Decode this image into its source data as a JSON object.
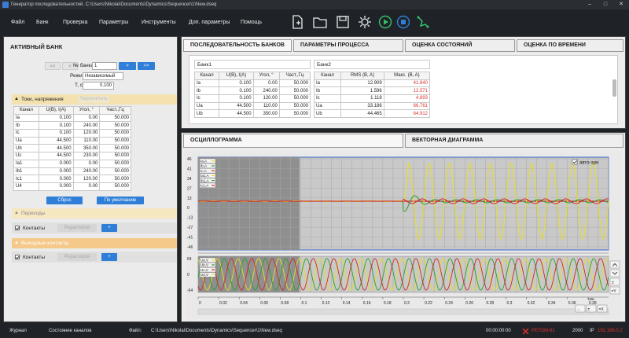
{
  "window": {
    "title": "Генератор последовательностей. C:\\Users\\Nikolai\\Documents\\Dynamics\\Sequencer\\1\\New.dseq"
  },
  "menu": {
    "items": [
      "Файл",
      "Банк",
      "Проверка",
      "Параметры",
      "Инструменты",
      "Доп. параметры",
      "Помощь"
    ]
  },
  "left": {
    "title": "АКТИВНЫЙ БАНК",
    "nav": {
      "first": "<<",
      "prev": "<",
      "bank_label": "№ банка",
      "bank_value": "1",
      "next": ">",
      "last": ">>"
    },
    "mode_label": "Режим",
    "mode_value": "Независимый",
    "t_label": "T, c",
    "t_value": "0.100",
    "currents_section": "Токи, напряжения",
    "recalc_label": "Пересчитать",
    "table_headers": [
      "Канал",
      "U(B), I(A)",
      "Угол, °",
      "Част.,Гц"
    ],
    "rows": [
      [
        "Ia",
        "0.100",
        "0.00",
        "50.000"
      ],
      [
        "Ib",
        "0.100",
        "240.00",
        "50.000"
      ],
      [
        "Ic",
        "0.100",
        "120.00",
        "50.000"
      ],
      [
        "Ua",
        "44.500",
        "110.00",
        "50.000"
      ],
      [
        "Ub",
        "44.500",
        "350.00",
        "50.000"
      ],
      [
        "Uc",
        "44.500",
        "230.00",
        "50.000"
      ],
      [
        "Ia1",
        "0.000",
        "0.00",
        "50.000"
      ],
      [
        "Ib1",
        "0.000",
        "240.00",
        "50.000"
      ],
      [
        "Ic1",
        "0.000",
        "120.00",
        "50.000"
      ],
      [
        "U4",
        "0.000",
        "0.00",
        "50.000"
      ]
    ],
    "reset_btn": "Сброс",
    "default_btn": "По умолчанию",
    "transitions_section": "Переходы",
    "contacts_label": "Контакты",
    "edit_label": "Редактиров",
    "plus": "+",
    "outputs_section": "Выходные контакты",
    "contacts2_label": "Контакты",
    "edit2_label": "Редактиров"
  },
  "top_tabs": [
    "ПОСЛЕДОВАТЕЛЬНОСТЬ БАНКОВ",
    "ПАРАМЕТРЫ ПРОЦЕССА",
    "ОЦЕНКА СОСТОЯНИЙ",
    "ОЦЕНКА ПО ВРЕМЕНИ"
  ],
  "bank1": {
    "title": "Банк1",
    "headers": [
      "Канал",
      "U(B), I(A)",
      "Угол, °",
      "Част.,Гц"
    ],
    "rows": [
      [
        "Ia",
        "0.100",
        "0.00",
        "50.000"
      ],
      [
        "Ib",
        "0.100",
        "240.00",
        "50.000"
      ],
      [
        "Ic",
        "0.100",
        "120.00",
        "50.000"
      ],
      [
        "Ua",
        "44.500",
        "110.00",
        "50.000"
      ],
      [
        "Ub",
        "44.500",
        "350.00",
        "50.000"
      ]
    ]
  },
  "bank2": {
    "title": "Банк2",
    "headers": [
      "Канал",
      "RMS (B, A)",
      "Макс. (B, A)"
    ],
    "rows": [
      [
        "Ia",
        "12.909",
        "41.840"
      ],
      [
        "Ib",
        "1.596",
        "12.571"
      ],
      [
        "Ic",
        "1.118",
        "4.893"
      ],
      [
        "Ua",
        "33.186",
        "66.761"
      ],
      [
        "Ub",
        "44.465",
        "64.912"
      ]
    ]
  },
  "bottom_tabs": [
    "ОСЦИЛЛОГРАММА",
    "ВЕКТОРНАЯ ДИАГРАММА"
  ],
  "osc": {
    "autozoom": "авто-зум",
    "y_ticks_top": [
      "46",
      "41",
      "34",
      "27",
      "13",
      "0",
      "-13",
      "-27",
      "-41",
      "-46"
    ],
    "y_ticks_bottom": [
      "64",
      "0",
      "-64"
    ],
    "x_ticks": [
      "0",
      "0.02",
      "0.04",
      "0.06",
      "0.08",
      "0.1",
      "0.12",
      "0.14",
      "0.16",
      "0.18",
      "0.2",
      "0.22",
      "0.24",
      "0.26",
      "0.28",
      "0.3",
      "0.32",
      "0.34",
      "0.36",
      "0.38"
    ],
    "x_unit": "сек.",
    "legend_top": [
      "Ia,A",
      "Ib,A",
      "Ic,A",
      "Ia1,A",
      "Ib1,A",
      "Ic1,A"
    ],
    "legend_bottom": [
      "Ua,V",
      "Ub,V",
      "Uc,V",
      "U4,V"
    ],
    "colors": {
      "ia": "#e8e020",
      "ib": "#2aa02a",
      "ic": "#d02828",
      "ua": "#e8e020",
      "ub": "#2aa02a",
      "uc": "#d02828"
    }
  },
  "status": {
    "journal": "Журнал",
    "channels": "Состояние каналов",
    "file_label": "Файл:",
    "file_path": "C:\\Users\\Nikolai\\Documents\\Dynamics\\Sequencer\\1\\New.dseq",
    "time": "00:00:00:00",
    "device": "РЕТОМ-61",
    "number": "2000",
    "ip_label": "IP",
    "ip_value": "192.168.0.2"
  }
}
